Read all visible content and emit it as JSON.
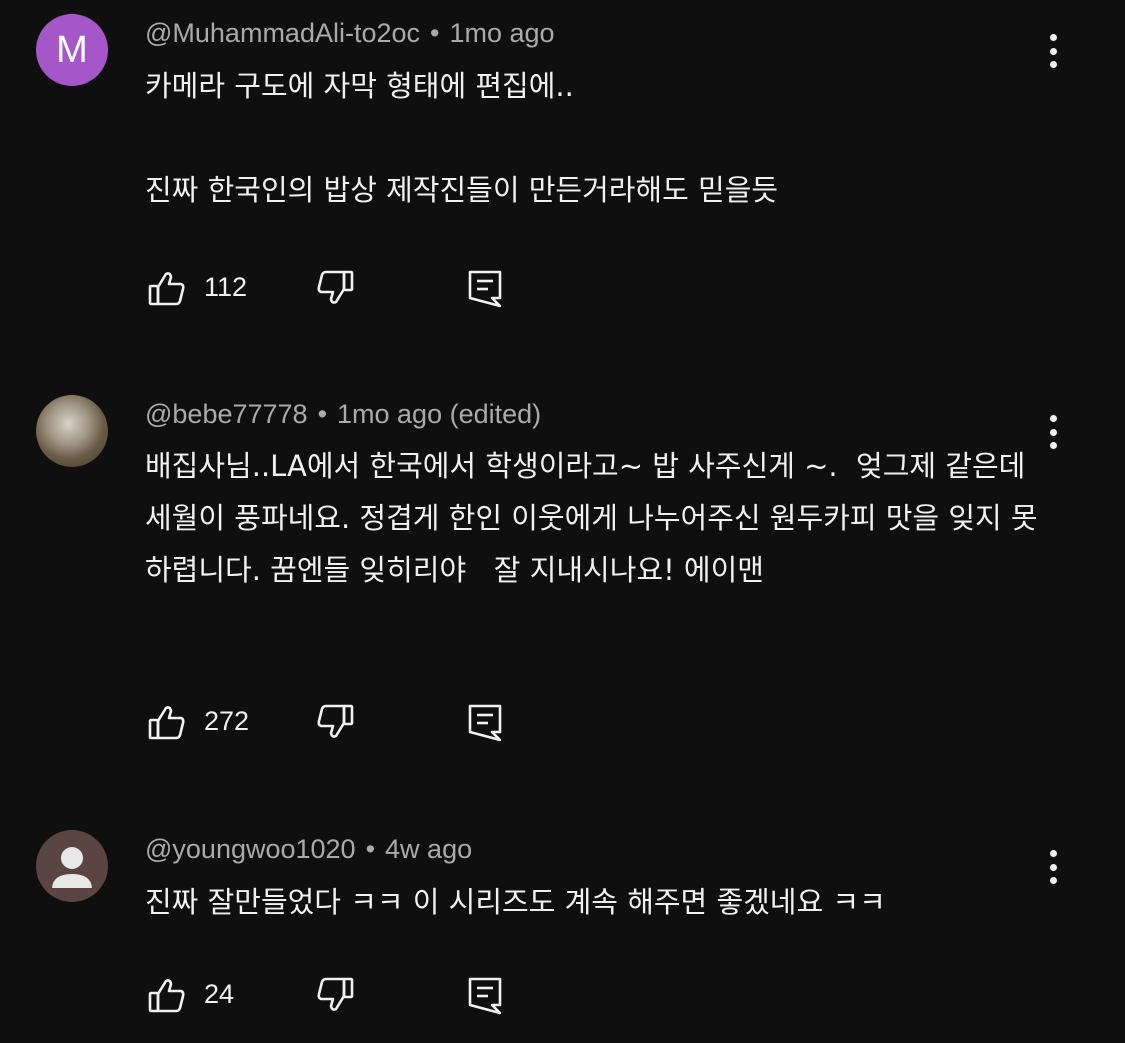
{
  "comments": [
    {
      "author": "@MuhammadAli-to2oc",
      "separator": "•",
      "time": "1mo ago",
      "avatar_letter": "M",
      "text": "카메라 구도에 자막 형태에 편집에..\n\n진짜 한국인의 밥상 제작진들이 만든거라해도 믿을듯",
      "likes": "112"
    },
    {
      "author": "@bebe77778",
      "separator": "•",
      "time": "1mo ago (edited)",
      "text": "배집사님..LA에서 한국에서 학생이라고~ 밥 사주신게 ~.  엊그제 같은데 세월이 풍파네요. 정겹게 한인 이웃에게 나누어주신 원두카피 맛을 잊지 못하렵니다. 꿈엔들 잊히리야   잘 지내시나요! 에이맨",
      "likes": "272"
    },
    {
      "author": "@youngwoo1020",
      "separator": "•",
      "time": "4w ago",
      "text": "진짜 잘만들었다 ㅋㅋ 이 시리즈도 계속 해주면 좋겠네요 ㅋㅋ",
      "likes": "24"
    }
  ],
  "icons": {
    "like": "thumb-up-icon",
    "dislike": "thumb-down-icon",
    "reply": "reply-icon",
    "more": "more-vert-icon"
  },
  "colors": {
    "background": "#0f0f0f",
    "text": "#f1f1f1",
    "meta": "#aaaaaa",
    "avatar_m": "#a557c9"
  }
}
